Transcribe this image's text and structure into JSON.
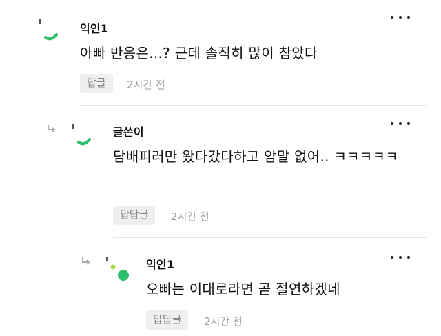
{
  "colors": {
    "accent_green": "#2ebd6b",
    "light_green": "#a6dc4a",
    "button_bg": "#efefef",
    "muted_text": "#999999"
  },
  "comments": [
    {
      "author": "익인1",
      "text": "아빠 반응은...? 근데 솔직히 많이 참았다",
      "reply_label": "답글",
      "time": "2시간 전",
      "avatar_icon": "green-arc-avatar-icon",
      "more_icon": "more-dots-icon"
    },
    {
      "author": "글쓴이",
      "text": "담배피러만 왔다갔다하고 암말 없어.. ㅋㅋㅋㅋㅋ",
      "reply_label": "답답글",
      "time": "2시간 전",
      "avatar_icon": "green-arc-avatar-icon",
      "reply_icon": "reply-arrow-icon",
      "more_icon": "more-dots-icon"
    },
    {
      "author": "익인1",
      "text": "오빠는 이대로라면 곧 절연하겠네",
      "reply_label": "답답글",
      "time": "2시간 전",
      "avatar_icon": "green-dots-avatar-icon",
      "reply_icon": "reply-arrow-icon",
      "more_icon": "more-dots-icon"
    }
  ]
}
